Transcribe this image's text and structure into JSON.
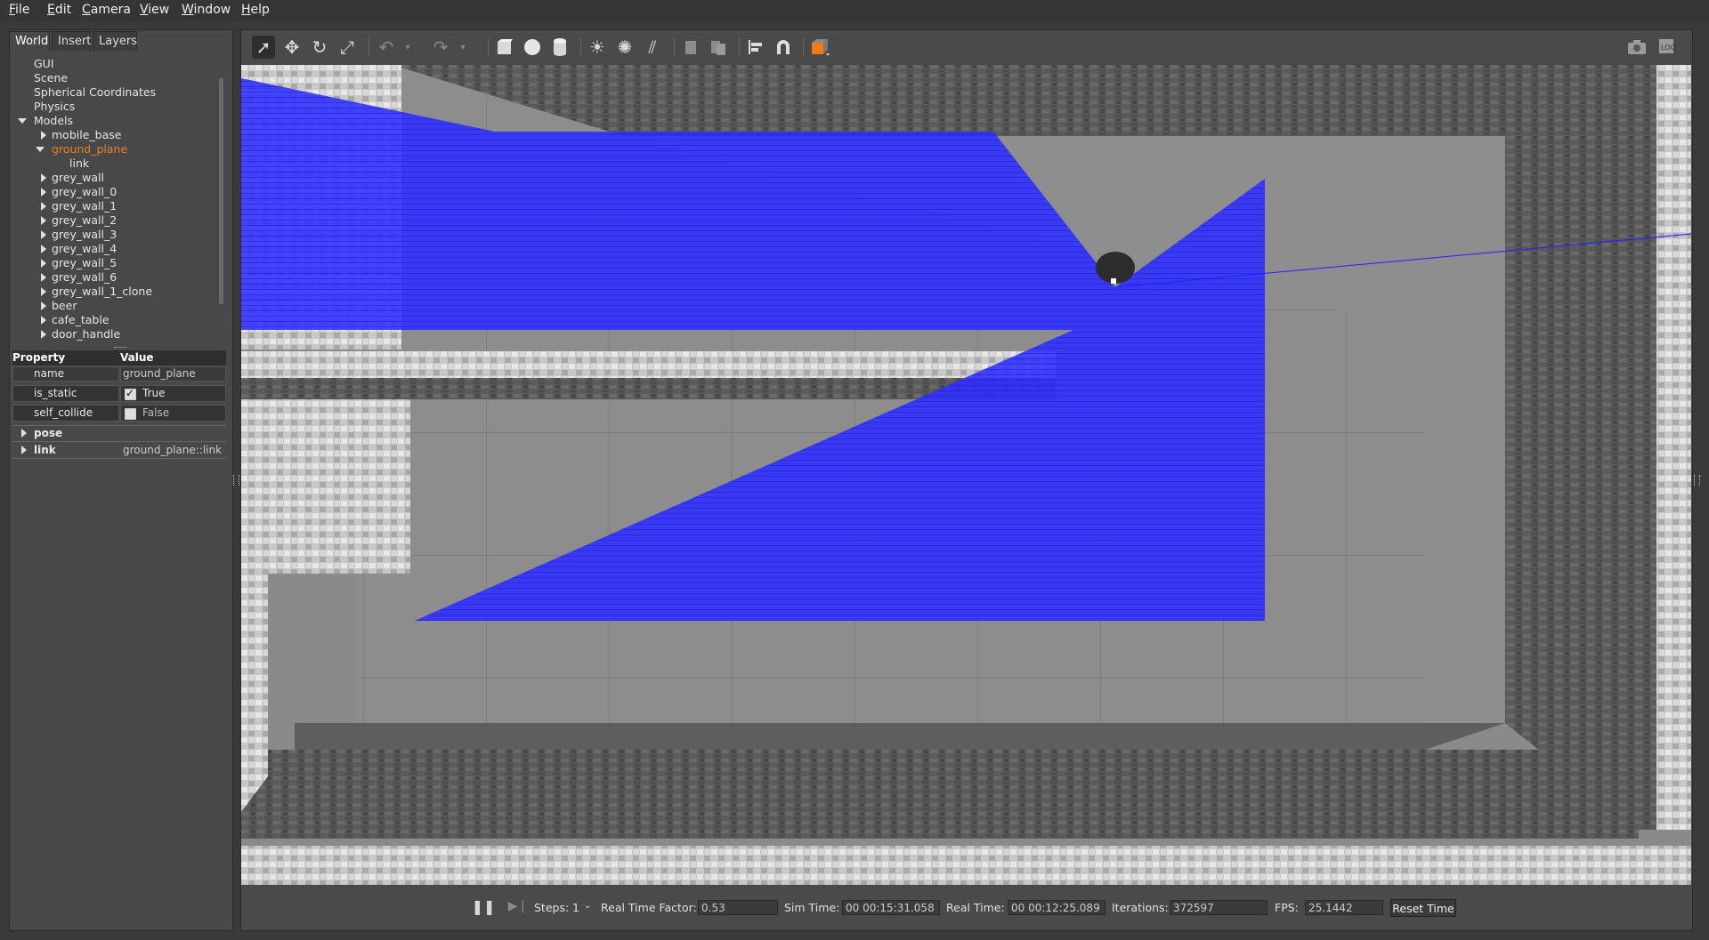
{
  "menu": [
    "File",
    "Edit",
    "Camera",
    "View",
    "Window",
    "Help"
  ],
  "tabs": [
    "World",
    "Insert",
    "Layers"
  ],
  "tree": {
    "items": [
      {
        "label": "GUI"
      },
      {
        "label": "Scene"
      },
      {
        "label": "Spherical Coordinates"
      },
      {
        "label": "Physics"
      },
      {
        "label": "Models"
      },
      {
        "label": "mobile_base"
      },
      {
        "label": "ground_plane"
      },
      {
        "label": "link"
      },
      {
        "label": "grey_wall"
      },
      {
        "label": "grey_wall_0"
      },
      {
        "label": "grey_wall_1"
      },
      {
        "label": "grey_wall_2"
      },
      {
        "label": "grey_wall_3"
      },
      {
        "label": "grey_wall_4"
      },
      {
        "label": "grey_wall_5"
      },
      {
        "label": "grey_wall_6"
      },
      {
        "label": "grey_wall_1_clone"
      },
      {
        "label": "beer"
      },
      {
        "label": "cafe_table"
      },
      {
        "label": "door_handle"
      }
    ],
    "selected": "ground_plane"
  },
  "properties": {
    "header_property": "Property",
    "header_value": "Value",
    "rows": [
      {
        "key": "name",
        "value": "ground_plane"
      },
      {
        "key": "is_static",
        "value": "True",
        "checked": true
      },
      {
        "key": "self_collide",
        "value": "False",
        "checked": false
      },
      {
        "key": "pose",
        "value": ""
      },
      {
        "key": "link",
        "value": "ground_plane::link"
      }
    ]
  },
  "toolbar": {
    "icons": [
      "select-arrow-icon",
      "translate-icon",
      "rotate-icon",
      "scale-icon",
      "undo-icon",
      "undo-dropdown-icon",
      "redo-icon",
      "redo-dropdown-icon",
      "box-icon",
      "sphere-icon",
      "cylinder-icon",
      "point-light-icon",
      "spot-light-icon",
      "directional-light-icon",
      "copy-icon",
      "paste-icon",
      "align-icon",
      "snap-magnet-icon",
      "view-angle-icon",
      "screenshot-icon",
      "log-icon"
    ]
  },
  "status": {
    "steps_label": "Steps:",
    "steps_value": "1",
    "rtf_label": "Real Time Factor:",
    "rtf_value": "0.53",
    "sim_label": "Sim Time:",
    "sim_value": "00 00:15:31.058",
    "real_label": "Real Time:",
    "real_value": "00 00:12:25.089",
    "iter_label": "Iterations:",
    "iter_value": "372597",
    "fps_label": "FPS:",
    "fps_value": "25.1442",
    "reset_label": "Reset Time"
  },
  "colors": {
    "selected_text": "#e8821e",
    "laser": "#2a2aff",
    "panel": "#484848"
  }
}
